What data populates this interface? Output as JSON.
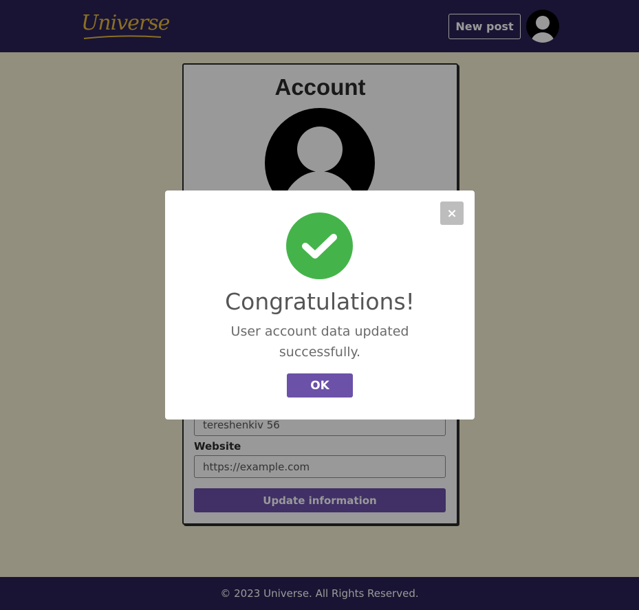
{
  "header": {
    "logo_text": "Universe",
    "new_post_label": "New post"
  },
  "account": {
    "title": "Account",
    "address_value": "tereshenkiv 56",
    "website_label": "Website",
    "website_placeholder": "https://example.com",
    "update_label": "Update information"
  },
  "modal": {
    "close_label": "×",
    "title": "Congratulations!",
    "message": "User account data updated successfully.",
    "ok_label": "OK"
  },
  "footer": {
    "copyright": "© 2023 Universe. All Rights Reserved."
  },
  "colors": {
    "header_bg": "#2a2256",
    "page_bg": "#f4efd3",
    "accent": "#6b51a8",
    "logo": "#e8b93c",
    "success": "#44b44a"
  },
  "icons": {
    "user_avatar": "user-silhouette-icon",
    "success": "check-circle-icon",
    "close": "close-icon"
  }
}
